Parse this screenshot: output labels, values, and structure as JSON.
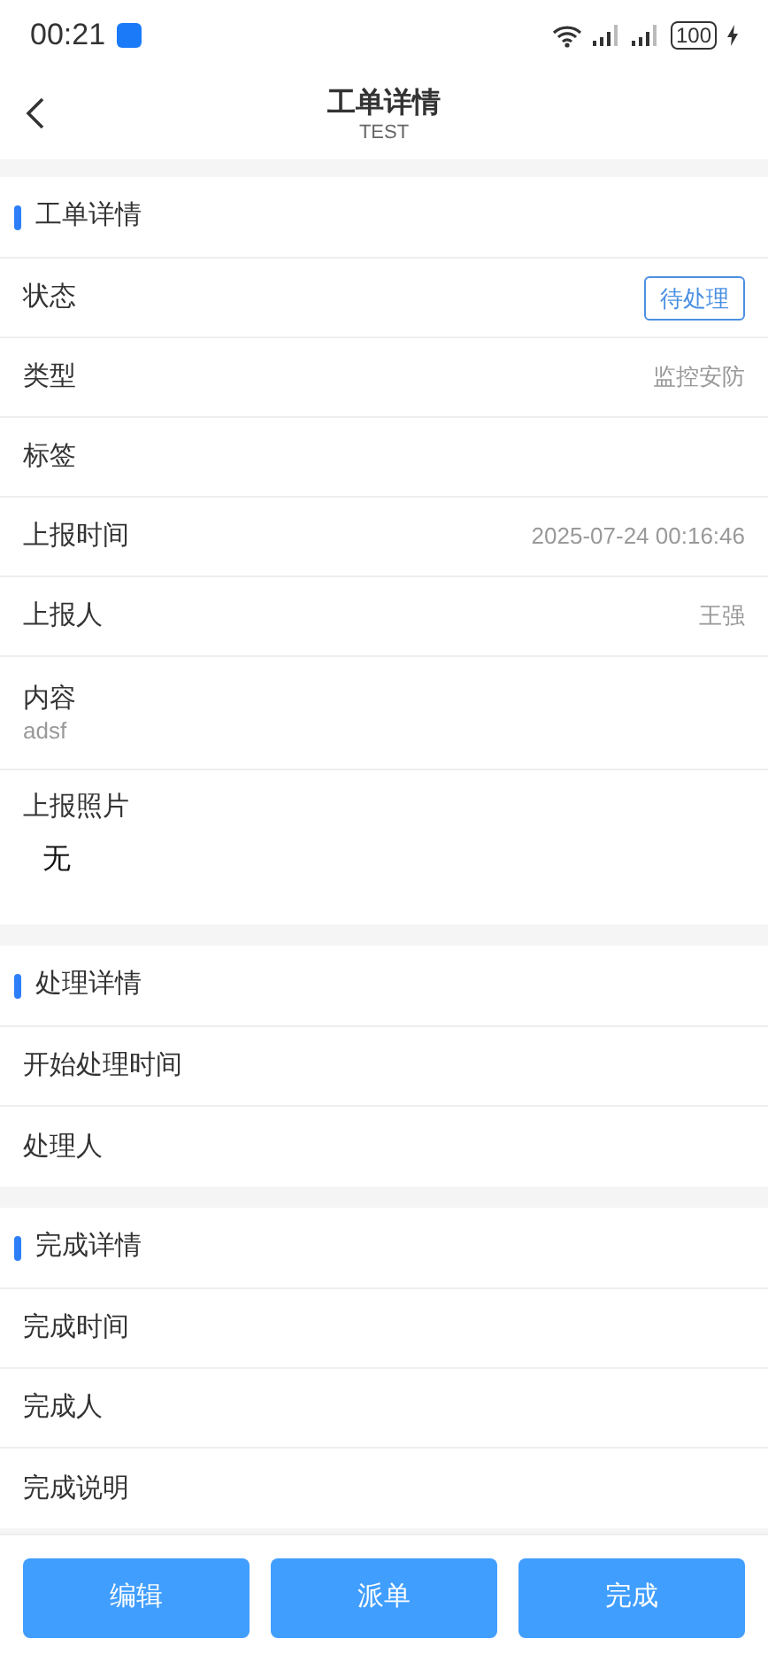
{
  "status_bar": {
    "time": "00:21",
    "battery": "100"
  },
  "header": {
    "title": "工单详情",
    "subtitle": "TEST"
  },
  "sections": [
    {
      "title": "工单详情",
      "rows": [
        {
          "kind": "tag",
          "label": "状态",
          "value": "待处理"
        },
        {
          "kind": "value",
          "label": "类型",
          "value": "监控安防"
        },
        {
          "kind": "value",
          "label": "标签"
        },
        {
          "kind": "value",
          "label": "上报时间",
          "value": "2025-07-24 00:16:46"
        },
        {
          "kind": "value",
          "label": "上报人",
          "value": "王强"
        },
        {
          "kind": "sub",
          "label": "内容",
          "value": "adsf"
        },
        {
          "kind": "photos",
          "label": "上报照片",
          "value": "无"
        }
      ]
    },
    {
      "title": "处理详情",
      "rows": [
        {
          "kind": "value",
          "label": "开始处理时间"
        },
        {
          "kind": "value",
          "label": "处理人"
        }
      ]
    },
    {
      "title": "完成详情",
      "rows": [
        {
          "kind": "value",
          "label": "完成时间"
        },
        {
          "kind": "value",
          "label": "完成人"
        },
        {
          "kind": "value",
          "label": "完成说明"
        }
      ]
    }
  ],
  "buttons": [
    "编辑",
    "派单",
    "完成"
  ]
}
